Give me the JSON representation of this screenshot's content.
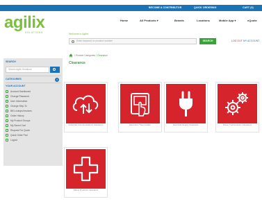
{
  "topbar": {
    "links": [
      "BECOME A CONTRIBUTOR",
      "QUICK ORDERING",
      "CART (0)"
    ],
    "color": "#1b72b5"
  },
  "logo": {
    "text": "agilix",
    "tagline": "SOLUTIONS",
    "color": "#7cbf3a"
  },
  "nav": {
    "items": [
      "Home",
      "All Products ▾",
      "Brands",
      "Locations",
      "Mobile App ▾",
      "eQuote"
    ]
  },
  "header": {
    "welcome": "Welcome to Agilix!",
    "search_placeholder": "Enter keyword or product number",
    "search_button": "SEARCH",
    "login": "LOG OUT",
    "account": "MY ACCOUNT"
  },
  "sidebar": {
    "search_title": "SEARCH",
    "search_placeholder": "Search Agilix Solutions",
    "categories_title": "CATEGORIES",
    "account_title": "YOUR ACCOUNT",
    "info_icon": "info-icon",
    "items": [
      {
        "label": "Account Dashboard"
      },
      {
        "label": "Change Password"
      },
      {
        "label": "User Information"
      },
      {
        "label": "Change Ship-To"
      },
      {
        "label": "Bill Lookups/Invoices"
      },
      {
        "label": "Order History"
      },
      {
        "label": "My Product Groups"
      },
      {
        "label": "My Saved Cart"
      },
      {
        "label": "Request For Quote"
      },
      {
        "label": "Quick Order Pad"
      },
      {
        "label": "Logout"
      }
    ]
  },
  "breadcrumb": {
    "home_icon": "home-icon",
    "items": [
      "Product Categories",
      "Clearance"
    ]
  },
  "page": {
    "title": "Clearance"
  },
  "categories": [
    {
      "label": "Industrial Communications Clearance",
      "icon": "cloud-transfer-icon"
    },
    {
      "label": "Electronic Thermostats",
      "icon": "touch-panel-icon"
    },
    {
      "label": "Electrical Supply Clearance",
      "icon": "power-plug-icon"
    },
    {
      "label": "Power Transmission Clearance",
      "icon": "gears-icon"
    },
    {
      "label": "Safety Products Clearance",
      "icon": "medical-cross-icon"
    }
  ],
  "colors": {
    "accent_green": "#3aa23a",
    "tile_red": "#d6242c",
    "sidebar_bg": "#e4e4e4"
  }
}
